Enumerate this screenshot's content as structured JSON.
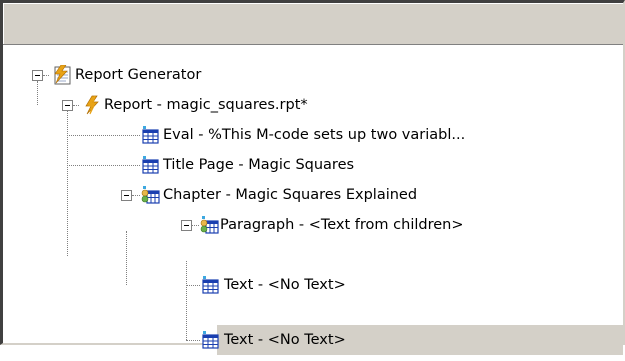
{
  "tree": {
    "items": [
      {
        "label": "Report Generator",
        "icon": "report-generator-icon",
        "depth": 0,
        "expanded": true
      },
      {
        "label": "Report - magic_squares.rpt*",
        "icon": "lightning-icon",
        "depth": 1,
        "expanded": true
      },
      {
        "label": "Eval - %This M-code sets up two variabl...",
        "icon": "table-component-icon",
        "depth": 2
      },
      {
        "label": "Title Page - Magic Squares",
        "icon": "table-component-icon",
        "depth": 2
      },
      {
        "label": "Chapter - Magic Squares Explained",
        "icon": "chapter-component-icon",
        "depth": 2,
        "expanded": true
      },
      {
        "label": "Paragraph - <Text from children>",
        "icon": "chapter-component-icon",
        "depth": 3,
        "expanded": true
      },
      {
        "label": "Text - <No Text>",
        "icon": "table-component-icon",
        "depth": 4
      },
      {
        "label": "Text - <No Text>",
        "icon": "table-component-icon",
        "depth": 4,
        "selected": true
      }
    ]
  },
  "colors": {
    "selection": "#d4d0c8",
    "header": "#d4d0c8",
    "lightning": "#e8a317",
    "table_icon": "#1a3fb0"
  }
}
